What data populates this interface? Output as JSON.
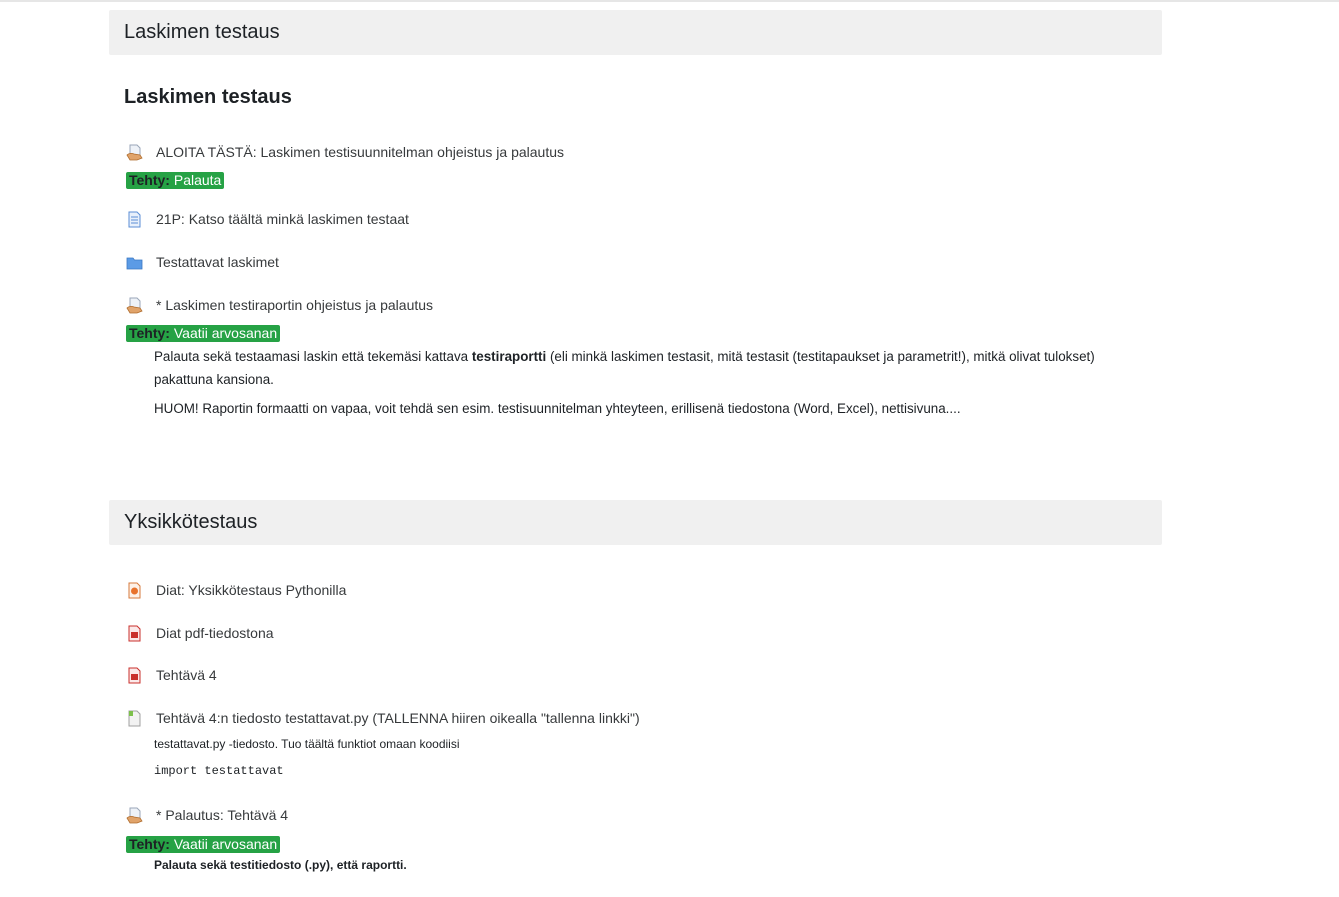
{
  "sections": [
    {
      "header": "Laskimen testaus",
      "summary_title": "Laskimen testaus",
      "activities": [
        {
          "label": "ALOITA TÄSTÄ: Laskimen testisuunnitelman ohjeistus ja palautus",
          "icon": "assignment-icon",
          "badge": {
            "key": "Tehty:",
            "value": "Palauta"
          }
        },
        {
          "label": "21P: Katso täältä minkä laskimen testaat",
          "icon": "page-icon"
        },
        {
          "label": "Testattavat laskimet",
          "icon": "folder-icon"
        },
        {
          "label": "* Laskimen testiraportin ohjeistus ja palautus",
          "icon": "assignment-icon",
          "badge": {
            "key": "Tehty:",
            "value": "Vaatii arvosanan"
          },
          "description": {
            "p1_before": "Palauta sekä testaamasi laskin että tekemäsi kattava ",
            "p1_bold": "testiraportti",
            "p1_after": " (eli minkä laskimen testasit, mitä testasit (testitapaukset ja parametrit!), mitkä olivat tulokset)",
            "p1_line2": "pakattuna kansiona.",
            "p2": "HUOM! Raportin formaatti on vapaa, voit tehdä sen esim. testisuunnitelman yhteyteen, erillisenä tiedostona (Word, Excel), nettisivuna...."
          }
        }
      ]
    },
    {
      "header": "Yksikkötestaus",
      "activities": [
        {
          "label": "Diat: Yksikkötestaus Pythonilla",
          "icon": "powerpoint-icon"
        },
        {
          "label": "Diat pdf-tiedostona",
          "icon": "pdf-icon"
        },
        {
          "label": "Tehtävä 4",
          "icon": "pdf-icon"
        },
        {
          "label": "Tehtävä 4:n tiedosto testattavat.py (TALLENNA hiiren oikealla \"tallenna linkki\")",
          "icon": "file-icon",
          "description": {
            "line1": "testattavat.py -tiedosto. Tuo täältä funktiot omaan koodiisi",
            "code": "import testattavat"
          }
        },
        {
          "label": "* Palautus: Tehtävä 4",
          "icon": "assignment-icon",
          "badge": {
            "key": "Tehty:",
            "value": "Vaatii arvosanan"
          },
          "description": {
            "bold_line": "Palauta sekä testitiedosto (.py), että raportti."
          }
        }
      ]
    }
  ],
  "colors": {
    "badge_green": "#26a245",
    "header_bg": "#f0f0f0",
    "text": "#373a3c"
  }
}
